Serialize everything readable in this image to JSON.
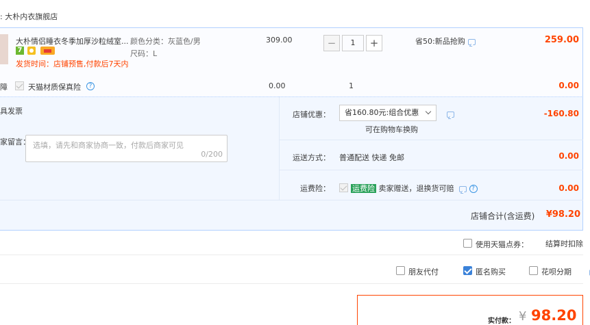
{
  "shop": {
    "name": ": 大朴内衣旗舰店"
  },
  "item": {
    "title": "大朴情侣睡衣冬季加厚沙粒绒室...",
    "badge_seven": "7",
    "shipping": "发货时间：店铺预售,付款后7天内",
    "color_label": "颜色分类：灰蓝色/男",
    "size_label": "尺码：L",
    "unit_price": "309.00",
    "quantity": "1",
    "minus": "−",
    "plus": "+",
    "promo": "省50:新品抢购",
    "subtotal": "259.00"
  },
  "insurance": {
    "prefix": "障",
    "label": "天猫材质保真险",
    "help": "?",
    "price": "0.00",
    "qty": "1",
    "subtotal": "0.00"
  },
  "invoice": {
    "label": "具发票"
  },
  "message": {
    "label": "家留言：",
    "placeholder": "选填，请先和商家协商一致，付款后商家可见",
    "counter": "0/200"
  },
  "shop_discount": {
    "label": "店铺优惠：",
    "selected": "省160.80元:组合优惠",
    "note": "可在购物车换购",
    "amount": "-160.80"
  },
  "delivery": {
    "label": "运送方式：",
    "value": "普通配送 快递 免邮",
    "amount": "0.00"
  },
  "freight_insurance": {
    "label": "运费险：",
    "tag": "运费险",
    "value": "卖家赠送，退换货可赔",
    "amount": "0.00"
  },
  "shop_total": {
    "label": "店铺合计(含运费)",
    "amount": "¥98.20"
  },
  "points": {
    "label": "使用天猫点券：",
    "note": "结算时扣除"
  },
  "options": {
    "friend_pay": "朋友代付",
    "anonymous": "匿名购买",
    "huabei": "花呗分期"
  },
  "payment": {
    "label": "实付款：",
    "currency": "¥",
    "amount": "98.20"
  },
  "colors": {
    "accent_red": "#ff4400",
    "border_blue": "#b2d1ff",
    "panel_bg": "#f2f7ff",
    "checkbox_blue": "#3b82d9",
    "tag_green": "#2aa15a"
  }
}
